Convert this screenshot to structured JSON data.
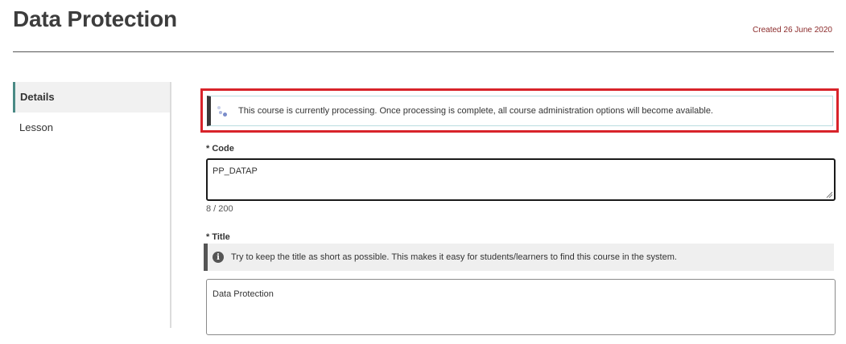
{
  "header": {
    "title": "Data Protection",
    "created": "Created 26 June 2020"
  },
  "sidebar": {
    "items": [
      {
        "label": "Details",
        "active": true
      },
      {
        "label": "Lesson",
        "active": false
      }
    ]
  },
  "alert": {
    "message": "This course is currently processing. Once processing is complete, all course administration options will become available."
  },
  "code_field": {
    "label": "* Code",
    "value": "PP_DATAP",
    "counter": "8 / 200"
  },
  "title_field": {
    "label": "* Title",
    "info": "Try to keep the title as short as possible. This makes it easy for students/learners to find this course in the system.",
    "value": "Data Protection"
  },
  "colors": {
    "highlight": "#d8232a",
    "active_accent": "#4a8a85",
    "created_text": "#8b2a2a"
  }
}
